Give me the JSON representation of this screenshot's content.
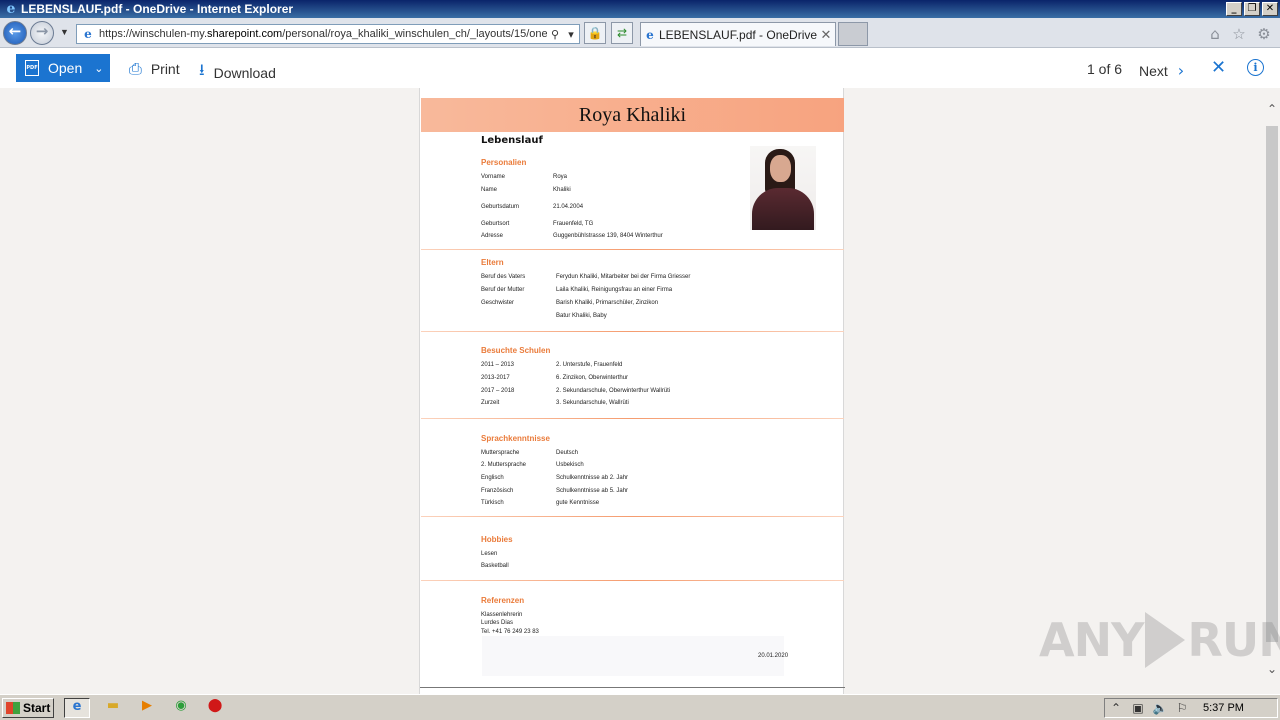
{
  "window": {
    "title": "LEBENSLAUF.pdf - OneDrive - Internet Explorer"
  },
  "browser": {
    "url_prefix": "https://winschulen-my.",
    "url_host": "sharepoint.com",
    "url_rest": "/personal/roya_khaliki_winschulen_ch/_layouts/15/one",
    "tab_title": "LEBENSLAUF.pdf - OneDrive"
  },
  "toolbar": {
    "open_label": "Open",
    "print_label": "Print",
    "download_label": "Download",
    "page_indicator": "1 of 6",
    "next_label": "Next"
  },
  "doc": {
    "name": "Roya Khaliki",
    "title": "Lebenslauf",
    "personalien": {
      "heading": "Personalien",
      "rows": [
        {
          "label": "Vorname",
          "value": "Roya"
        },
        {
          "label": "Name",
          "value": "Khaliki"
        },
        {
          "label": "Geburtsdatum",
          "value": "21.04.2004"
        },
        {
          "label": "Geburtsort",
          "value": "Frauenfeld, TG"
        },
        {
          "label": "Adresse",
          "value": "Guggenbühlstrasse 139,  8404 Winterthur"
        }
      ]
    },
    "eltern": {
      "heading": "Eltern",
      "rows": [
        {
          "label": "Beruf des Vaters",
          "value": "Ferydun Khaliki, Mitarbeiter bei der Firma  Griesser"
        },
        {
          "label": "Beruf der Mutter",
          "value": "Laila Khaliki, Reinigungsfrau an einer Firma"
        },
        {
          "label": "Geschwister",
          "value": "Barish Khaliki,  Primarschüler, Zinzikon"
        },
        {
          "label": "",
          "value": "Batur Khaliki, Baby"
        }
      ]
    },
    "schulen": {
      "heading": "Besuchte Schulen",
      "rows": [
        {
          "label": "2011 – 2013",
          "value": "2. Unterstufe, Frauenfeld"
        },
        {
          "label": "2013-2017",
          "value": "6. Zinzikon, Oberwinterthur"
        },
        {
          "label": "2017 – 2018",
          "value": "2. Sekundarschule, Oberwinterthur Wallrüti"
        },
        {
          "label": "Zurzeit",
          "value": "3. Sekundarschule, Wallrüti"
        }
      ]
    },
    "sprachen": {
      "heading": "Sprachkenntnisse",
      "rows": [
        {
          "label": "Muttersprache",
          "value": "Deutsch"
        },
        {
          "label": "2. Muttersprache",
          "value": "Usbekisch"
        },
        {
          "label": "Englisch",
          "value": "Schulkenntnisse ab 2. Jahr"
        },
        {
          "label": "Französisch",
          "value": "Schulkenntnisse ab 5. Jahr"
        },
        {
          "label": "Türkisch",
          "value": "gute Kenntnisse"
        }
      ]
    },
    "hobbies": {
      "heading": "Hobbies",
      "items": [
        "Lesen",
        "Basketball"
      ]
    },
    "referenzen": {
      "heading": "Referenzen",
      "lines": [
        "Klassenlehrerin",
        "Lurdes Dias",
        "Tel. +41 76 249 23 83"
      ]
    },
    "date": "20.01.2020"
  },
  "watermark": {
    "left": "ANY",
    "right": "RUN"
  },
  "taskbar": {
    "start_label": "Start",
    "clock": "5:37 PM"
  },
  "colors": {
    "accent": "#1b74d0",
    "section_heading": "#ea7b3a",
    "name_banner": "#f7a37f",
    "viewer_bg": "#f4f2f0"
  }
}
